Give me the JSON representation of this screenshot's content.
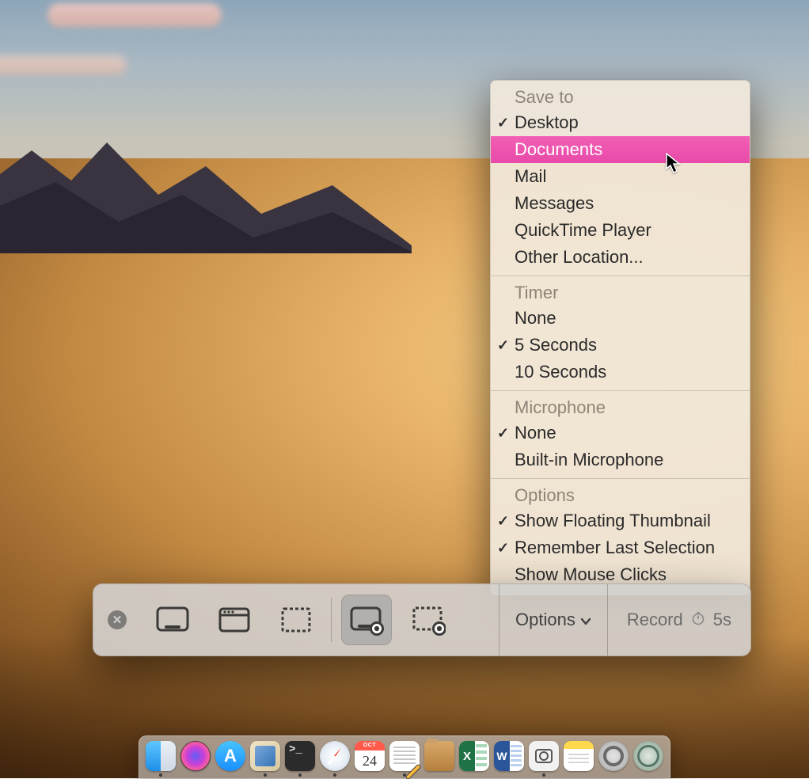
{
  "menu": {
    "sections": [
      {
        "title": "Save to",
        "items": [
          {
            "label": "Desktop",
            "checked": true
          },
          {
            "label": "Documents",
            "highlight": true
          },
          {
            "label": "Mail"
          },
          {
            "label": "Messages"
          },
          {
            "label": "QuickTime Player"
          },
          {
            "label": "Other Location..."
          }
        ]
      },
      {
        "title": "Timer",
        "items": [
          {
            "label": "None"
          },
          {
            "label": "5 Seconds",
            "checked": true
          },
          {
            "label": "10 Seconds"
          }
        ]
      },
      {
        "title": "Microphone",
        "items": [
          {
            "label": "None",
            "checked": true
          },
          {
            "label": "Built-in Microphone"
          }
        ]
      },
      {
        "title": "Options",
        "items": [
          {
            "label": "Show Floating Thumbnail",
            "checked": true
          },
          {
            "label": "Remember Last Selection",
            "checked": true
          },
          {
            "label": "Show Mouse Clicks"
          }
        ]
      }
    ]
  },
  "toolbar": {
    "options_label": "Options",
    "record_label": "Record",
    "record_timer": "5s",
    "buttons": [
      {
        "name": "capture-entire-screen",
        "selected": false
      },
      {
        "name": "capture-window",
        "selected": false
      },
      {
        "name": "capture-selection",
        "selected": false
      },
      {
        "name": "record-entire-screen",
        "selected": true
      },
      {
        "name": "record-selection",
        "selected": false
      }
    ]
  },
  "calendar": {
    "month": "OCT",
    "day": "24"
  },
  "dock": [
    {
      "name": "finder",
      "running": true
    },
    {
      "name": "siri",
      "running": false
    },
    {
      "name": "app-store",
      "running": false
    },
    {
      "name": "preview",
      "running": true
    },
    {
      "name": "terminal",
      "running": true
    },
    {
      "name": "safari",
      "running": true
    },
    {
      "name": "calendar",
      "running": false
    },
    {
      "name": "textedit",
      "running": true
    },
    {
      "name": "folder",
      "running": false
    },
    {
      "name": "excel",
      "running": false
    },
    {
      "name": "word",
      "running": false
    },
    {
      "name": "screenshot",
      "running": true
    },
    {
      "name": "notes",
      "running": false
    },
    {
      "name": "system-preferences",
      "running": false
    },
    {
      "name": "disk-utility",
      "running": false
    }
  ]
}
